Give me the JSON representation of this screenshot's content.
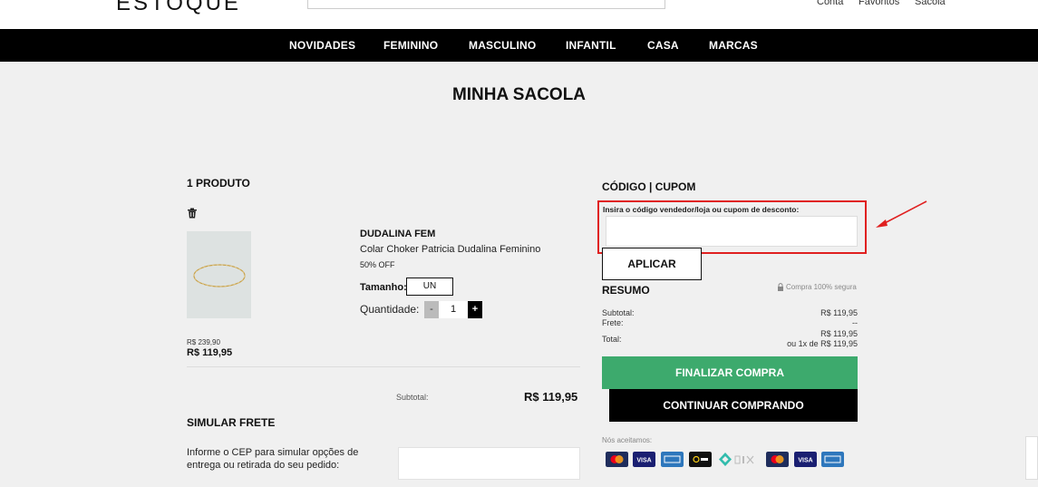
{
  "header": {
    "logo": "ESTOQUE",
    "links": [
      "Conta",
      "Favoritos",
      "Sacola"
    ]
  },
  "nav": {
    "items": [
      "NOVIDADES",
      "FEMININO",
      "MASCULINO",
      "INFANTIL",
      "CASA",
      "MARCAS"
    ]
  },
  "page_title": "MINHA SACOLA",
  "cart": {
    "count_label": "1 PRODUTO",
    "item": {
      "brand": "DUDALINA FEM",
      "name": "Colar Choker Patricia Dudalina Feminino",
      "discount": "50% OFF",
      "size_label": "Tamanho:",
      "size_value": "UN",
      "qty_label": "Quantidade:",
      "qty_minus": "-",
      "qty_value": "1",
      "qty_plus": "+",
      "old_price": "R$ 239,90",
      "price": "R$ 119,95"
    },
    "subtotal_label": "Subtotal:",
    "subtotal_value": "R$ 119,95"
  },
  "shipping": {
    "title": "SIMULAR FRETE",
    "description_line1": "Informe o CEP para simular opções de",
    "description_line2": "entrega ou retirada do seu pedido:",
    "cep_value": ""
  },
  "coupon": {
    "title": "CÓDIGO | CUPOM",
    "label": "Insira o código vendedor/loja ou cupom de desconto:",
    "value": "",
    "apply_label": "APLICAR"
  },
  "summary": {
    "title": "RESUMO",
    "secure": "Compra 100% segura",
    "subtotal_label": "Subtotal:",
    "subtotal_value": "R$ 119,95",
    "shipping_label": "Frete:",
    "shipping_value": "--",
    "total_label": "Total:",
    "total_value": "R$ 119,95",
    "installments": "ou 1x de R$ 119,95",
    "checkout_label": "FINALIZAR COMPRA",
    "continue_label": "CONTINUAR COMPRANDO",
    "payments_label": "Nós aceitamos:"
  },
  "payment_icons": [
    "mastercard-icon",
    "visa-icon",
    "amex-icon",
    "elo-icon",
    "pix-icon",
    "mastercard-icon",
    "visa-icon",
    "amex-icon"
  ],
  "colors": {
    "accent_green": "#3daa6d",
    "highlight_red": "#e02020",
    "nav_bg": "#000000"
  }
}
